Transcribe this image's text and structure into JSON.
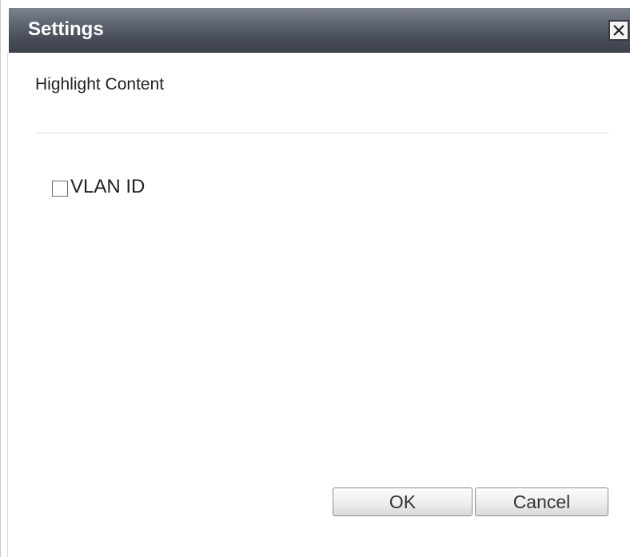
{
  "dialog": {
    "title": "Settings",
    "close_icon": "close-icon"
  },
  "section": {
    "title": "Highlight Content"
  },
  "options": [
    {
      "label": "VLAN ID",
      "checked": false
    }
  ],
  "buttons": {
    "ok_label": "OK",
    "cancel_label": "Cancel"
  },
  "colors": {
    "titlebar_top": "#7d828e",
    "titlebar_bottom": "#3d424d",
    "title_text": "#ffffff"
  }
}
